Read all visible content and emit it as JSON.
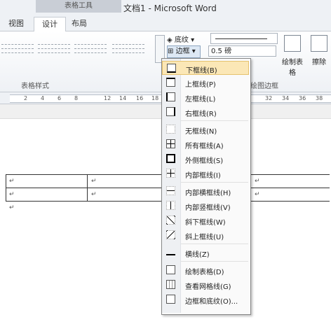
{
  "window": {
    "title": "文档1 - Microsoft Word",
    "context_tab": "表格工具"
  },
  "tabs": [
    {
      "label": "视图"
    },
    {
      "label": "设计",
      "active": true
    },
    {
      "label": "布局"
    }
  ],
  "ribbon": {
    "styles_group_label": "表格样式",
    "shading_label": "底纹",
    "borders_label": "边框",
    "pen_weight": "0.5 磅",
    "draw_table_label": "绘制表格",
    "eraser_label": "擦除",
    "draw_borders_group_label": "绘图边框"
  },
  "ruler": {
    "numbers": [
      "2",
      "4",
      "6",
      "8",
      "12",
      "14",
      "16",
      "18",
      "32",
      "34",
      "36",
      "38"
    ]
  },
  "document": {
    "paragraph_mark": "↵"
  },
  "borders_menu": {
    "items": [
      {
        "label": "下框线(B)",
        "icon": "bottom-border-icon",
        "highlighted": true
      },
      {
        "label": "上框线(P)",
        "icon": "top-border-icon"
      },
      {
        "label": "左框线(L)",
        "icon": "left-border-icon"
      },
      {
        "label": "右框线(R)",
        "icon": "right-border-icon"
      },
      {
        "label": "无框线(N)",
        "icon": "no-border-icon"
      },
      {
        "label": "所有框线(A)",
        "icon": "all-borders-icon"
      },
      {
        "label": "外侧框线(S)",
        "icon": "outside-borders-icon"
      },
      {
        "label": "内部框线(I)",
        "icon": "inside-borders-icon"
      },
      {
        "label": "内部横框线(H)",
        "icon": "inside-horizontal-border-icon"
      },
      {
        "label": "内部竖框线(V)",
        "icon": "inside-vertical-border-icon"
      },
      {
        "label": "斜下框线(W)",
        "icon": "diagonal-down-border-icon"
      },
      {
        "label": "斜上框线(U)",
        "icon": "diagonal-up-border-icon"
      },
      {
        "label": "横线(Z)",
        "icon": "horizontal-line-icon"
      },
      {
        "label": "绘制表格(D)",
        "icon": "draw-table-icon"
      },
      {
        "label": "查看网格线(G)",
        "icon": "view-gridlines-icon"
      },
      {
        "label": "边框和底纹(O)...",
        "icon": "borders-and-shading-icon"
      }
    ]
  }
}
